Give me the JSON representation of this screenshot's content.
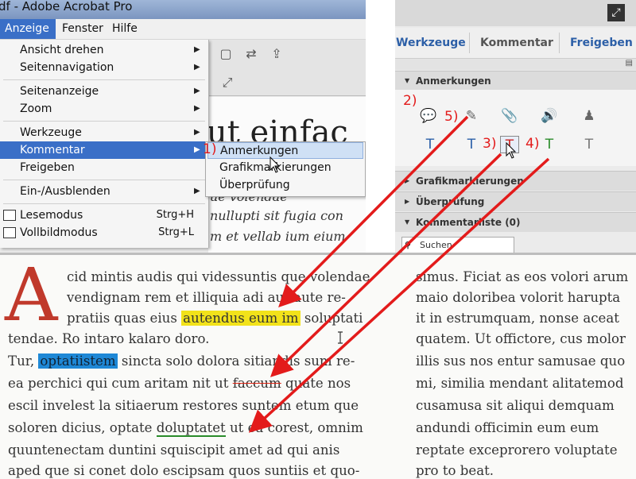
{
  "window": {
    "title": "df - Adobe Acrobat Pro"
  },
  "menubar": {
    "anzeige": "Anzeige",
    "fenster": "Fenster",
    "hilfe": "Hilfe"
  },
  "dropdown": {
    "items": [
      {
        "label": "Ansicht drehen"
      },
      {
        "label": "Seitennavigation"
      },
      {
        "label": "Seitenanzeige"
      },
      {
        "label": "Zoom"
      },
      {
        "label": "Werkzeuge"
      },
      {
        "label": "Kommentar"
      },
      {
        "label": "Freigeben"
      },
      {
        "label": "Ein-/Ausblenden"
      },
      {
        "label": "Lesemodus",
        "shortcut": "Strg+H"
      },
      {
        "label": "Vollbildmodus",
        "shortcut": "Strg+L"
      }
    ]
  },
  "submenu": {
    "items": [
      {
        "label": "Anmerkungen"
      },
      {
        "label": "Grafikmarkierungen"
      },
      {
        "label": "Überprüfung"
      }
    ]
  },
  "doc_behind": {
    "heading": "ut einfac",
    "lines": [
      "ue volendae",
      "nullupti sit fugia con",
      "m et vellab ium eium"
    ]
  },
  "right_panel": {
    "tabs": {
      "werkzeuge": "Werkzeuge",
      "kommentar": "Kommentar",
      "freigeben": "Freigeben"
    },
    "sections": {
      "anmerkungen": "Anmerkungen",
      "grafik": "Grafikmarkierungen",
      "ueberpruefung": "Überprüfung",
      "kommentarliste": "Kommentarliste (0)"
    },
    "search_placeholder": "Suchen"
  },
  "annotations": {
    "n1": "1)",
    "n2": "2)",
    "n3": "3)",
    "n4": "4)",
    "n5": "5)"
  },
  "document": {
    "dropcap": "A",
    "left_lines": [
      "cid mintis audis qui videssuntis que volendae",
      "vendignam rem et illiquia adi aut aute re-",
      "pratiis quas eius",
      "autendus eum im",
      "soluptati",
      "tendae. Ro intaro kalaro doro.",
      "Tur,",
      "optatiistem",
      "sincta solo dolora sitiandis sum re-",
      "ea perchici qui cum aritam nit ut",
      "faccum",
      "quate nos",
      "escil invelest la sitiaerum restores suntem etum que",
      "soloren dicius, optate",
      "doluptatet",
      "ut ea corest, omnim",
      "quuntenectam duntini squiscipit amet ad qui anis",
      "aped que si conet dolo escipsam quos suntiis et quo-"
    ],
    "right_lines": [
      "simus. Ficiat as eos volori arum",
      "maio doloribea volorit harupta",
      "it in estrumquam, nonse aceat",
      "quatem. Ut offictore, cus molor",
      "illis sus nos entur samusae quo",
      "mi, similia mendant alitatemod",
      "cusamusa sit aliqui demquam",
      "andundi officimin eum eum",
      "reptate exceprorero voluptate",
      "pro to beat."
    ]
  },
  "colors": {
    "accent": "#3a6fc7",
    "annotation_red": "#e31b1b",
    "highlight_yellow": "#f2e21a",
    "highlight_blue": "#1e88d6",
    "dropcap": "#c0392b"
  }
}
